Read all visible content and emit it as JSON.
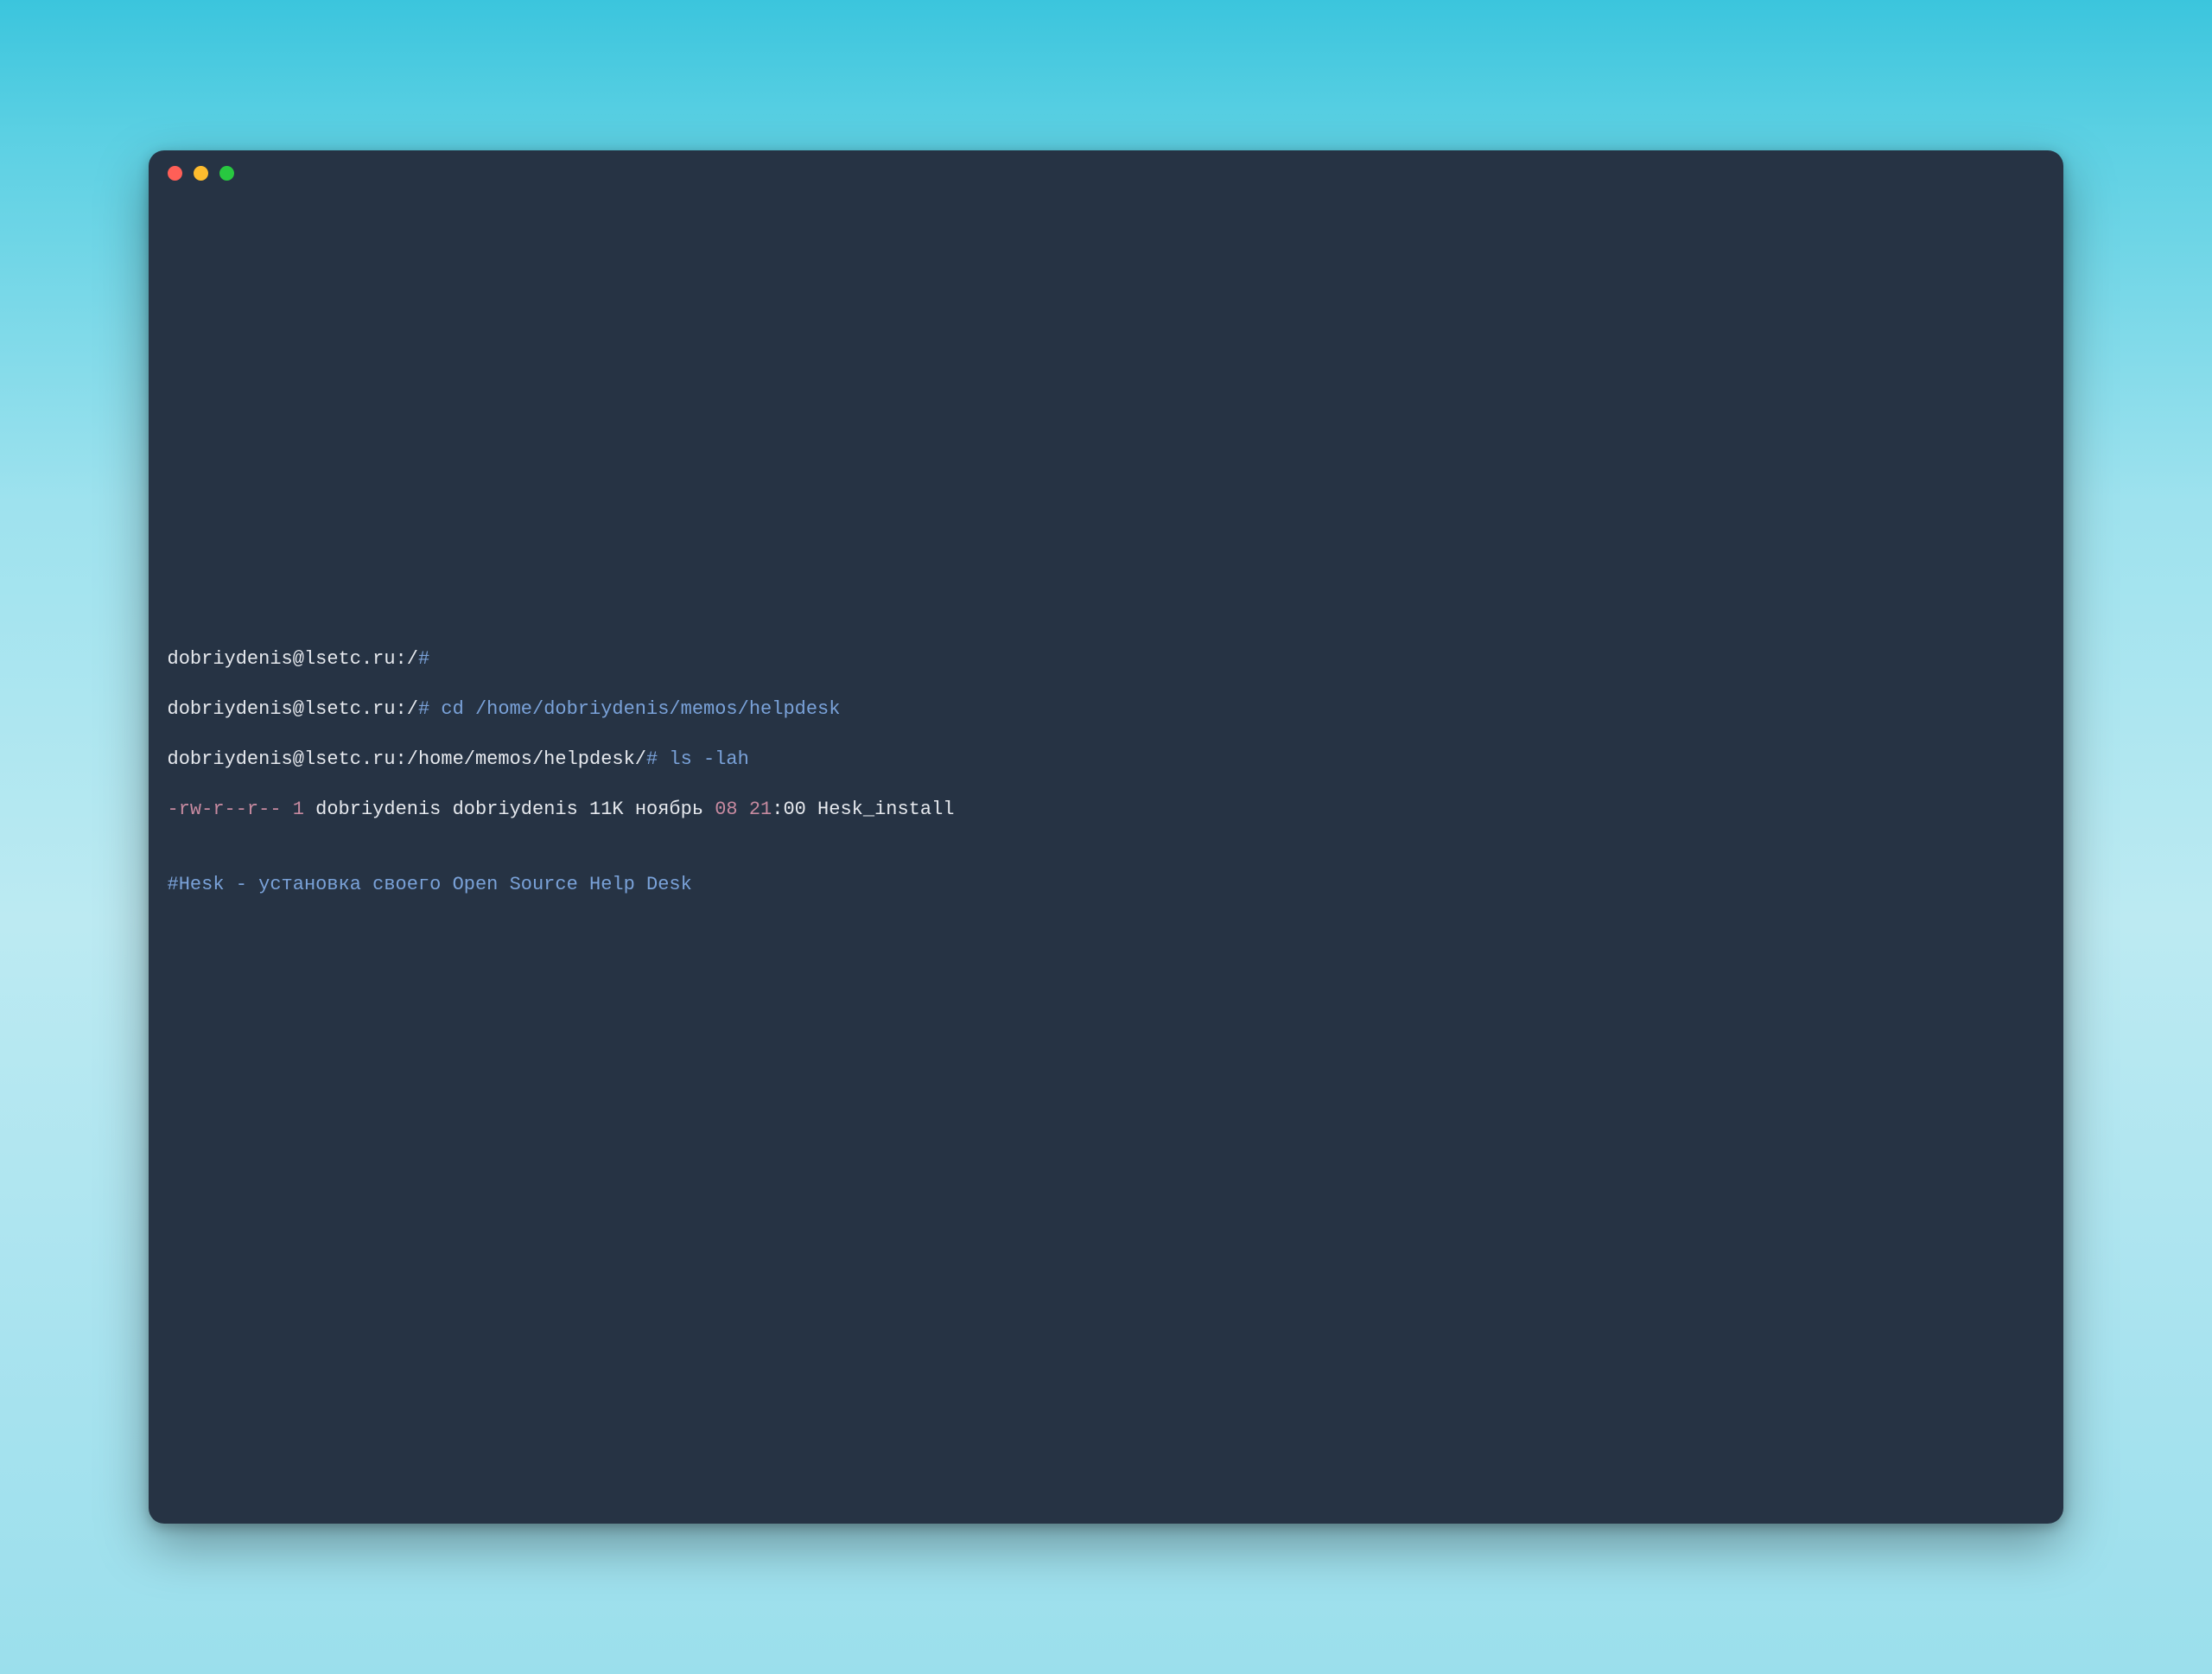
{
  "titlebar": {
    "close": "close",
    "minimize": "minimize",
    "zoom": "zoom"
  },
  "colors": {
    "bg": "#263344",
    "text": "#e6e9ee",
    "blue": "#7aa2d9",
    "accent": "#c78aa0"
  },
  "lines": {
    "l1": {
      "prompt": "dobriydenis@lsetc.ru:/",
      "hash": "#"
    },
    "l2": {
      "prompt": "dobriydenis@lsetc.ru:/",
      "cmd": "# cd /home/dobriydenis/memos/helpdesk"
    },
    "l3": {
      "prompt": "dobriydenis@lsetc.ru:/home/memos/helpdesk/",
      "cmd": "# ls -lah"
    },
    "l4": {
      "perm": "-rw-r--r-- ",
      "links": "1",
      "own": " dobriydenis dobriydenis 11K ноябрь ",
      "day": "08",
      "sp1": " ",
      "hour": "21",
      "rest": ":00 Hesk_install"
    },
    "blank": "",
    "l6": "#Hesk - установка своего Open Source Help Desk"
  }
}
